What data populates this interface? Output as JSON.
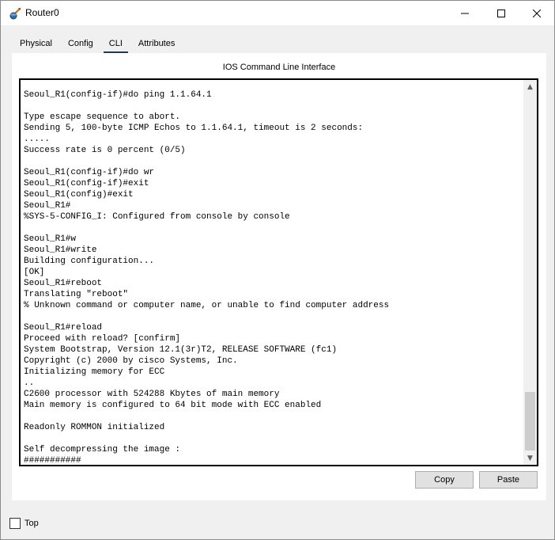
{
  "window": {
    "title": "Router0",
    "icon": "router-icon"
  },
  "tabs": [
    {
      "label": "Physical",
      "active": false
    },
    {
      "label": "Config",
      "active": false
    },
    {
      "label": "CLI",
      "active": true
    },
    {
      "label": "Attributes",
      "active": false
    }
  ],
  "cli": {
    "heading": "IOS Command Line Interface",
    "lines": [
      "Seoul_R1(config-if)#do ping 1.1.64.1",
      "",
      "Type escape sequence to abort.",
      "Sending 5, 100-byte ICMP Echos to 1.1.64.1, timeout is 2 seconds:",
      ".....",
      "Success rate is 0 percent (0/5)",
      "",
      "Seoul_R1(config-if)#do wr",
      "Seoul_R1(config-if)#exit",
      "Seoul_R1(config)#exit",
      "Seoul_R1#",
      "%SYS-5-CONFIG_I: Configured from console by console",
      "",
      "Seoul_R1#w",
      "Seoul_R1#write",
      "Building configuration...",
      "[OK]",
      "Seoul_R1#reboot",
      "Translating \"reboot\"",
      "% Unknown command or computer name, or unable to find computer address",
      "",
      "Seoul_R1#reload",
      "Proceed with reload? [confirm]",
      "System Bootstrap, Version 12.1(3r)T2, RELEASE SOFTWARE (fc1)",
      "Copyright (c) 2000 by cisco Systems, Inc.",
      "Initializing memory for ECC",
      "..",
      "C2600 processor with 524288 Kbytes of main memory",
      "Main memory is configured to 64 bit mode with ECC enabled",
      "",
      "Readonly ROMMON initialized",
      "",
      "Self decompressing the image :",
      "###########"
    ],
    "copy_label": "Copy",
    "paste_label": "Paste"
  },
  "footer": {
    "top_label": "Top",
    "top_checked": false
  }
}
